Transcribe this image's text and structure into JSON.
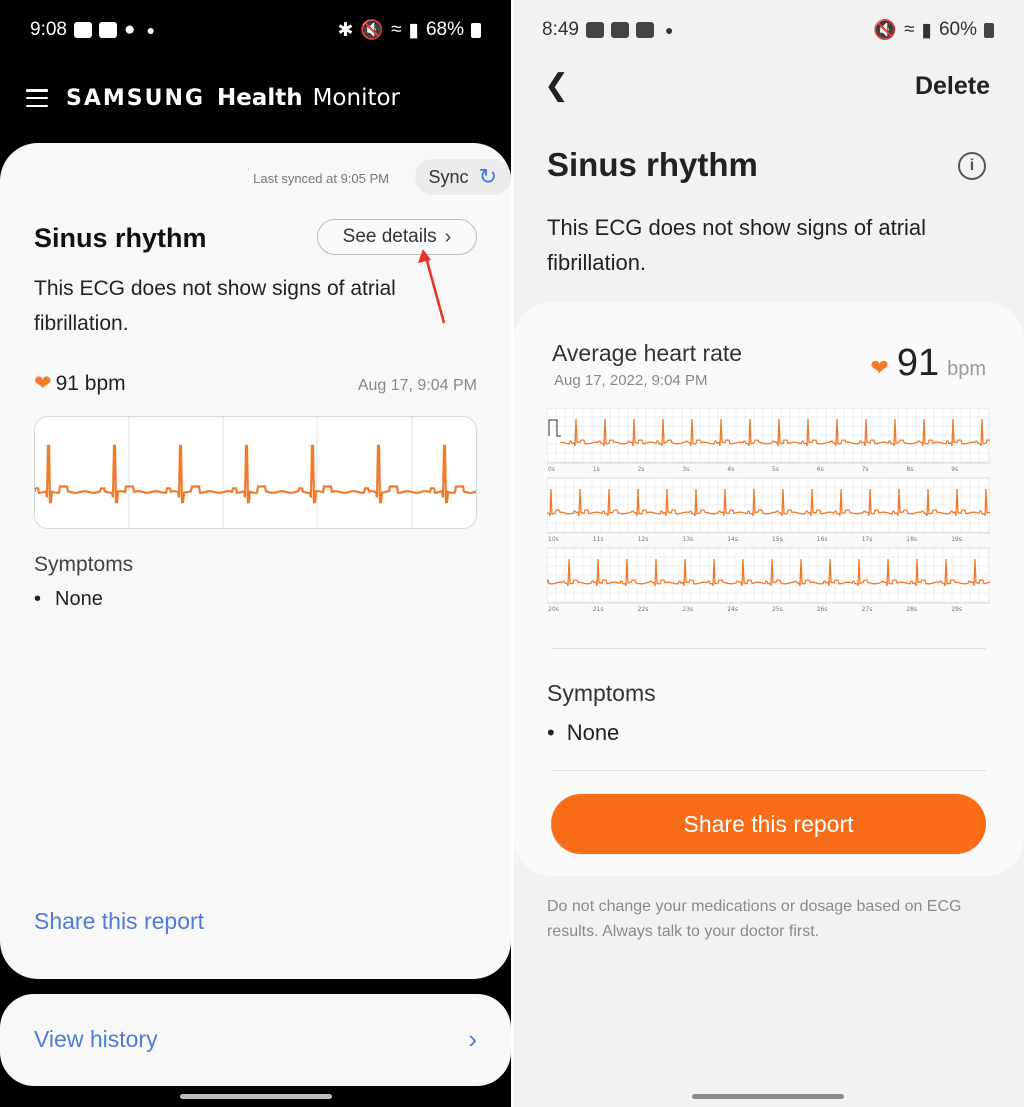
{
  "left": {
    "status_bar": {
      "time": "9:08",
      "battery": "68%"
    },
    "app_header": {
      "brand": "SAMSUNG",
      "health": "Health",
      "monitor": "Monitor"
    },
    "sync": {
      "last_synced": "Last synced at 9:05 PM",
      "label": "Sync"
    },
    "result": {
      "title": "Sinus rhythm",
      "details_label": "See details",
      "description": "This ECG does not show signs of atrial fibrillation.",
      "heart_rate": "91 bpm",
      "date": "Aug 17, 9:04 PM"
    },
    "symptoms": {
      "label": "Symptoms",
      "value": "None"
    },
    "share_label": "Share this report",
    "history_label": "View history"
  },
  "right": {
    "status_bar": {
      "time": "8:49",
      "battery": "60%"
    },
    "delete_label": "Delete",
    "title": "Sinus rhythm",
    "description": "This ECG does not show signs of atrial fibrillation.",
    "avg_hr": {
      "label": "Average heart rate",
      "date": "Aug 17, 2022, 9:04 PM",
      "value": "91",
      "unit": "bpm"
    },
    "strip_labels": [
      [
        "0s",
        "1s",
        "2s",
        "3s",
        "4s",
        "5s",
        "6s",
        "7s",
        "8s",
        "9s"
      ],
      [
        "10s",
        "11s",
        "12s",
        "13s",
        "14s",
        "15s",
        "16s",
        "17s",
        "18s",
        "19s"
      ],
      [
        "20s",
        "21s",
        "22s",
        "23s",
        "24s",
        "25s",
        "26s",
        "27s",
        "28s",
        "29s"
      ]
    ],
    "symptoms": {
      "label": "Symptoms",
      "value": "None"
    },
    "share_label": "Share this report",
    "disclaimer": "Do not change your medications or dosage based on ECG results. Always talk to your doctor first."
  },
  "colors": {
    "accent_orange": "#fa6d18",
    "ecg_line": "#f07a2c",
    "link_blue": "#4e7bd9",
    "sync_icon": "#3f7be0"
  },
  "icons": {
    "menu": "hamburger-icon",
    "sync": "refresh-icon",
    "chevron": "chevron-right-icon",
    "heart": "heart-icon",
    "back": "arrow-back-icon",
    "info": "info-icon"
  }
}
